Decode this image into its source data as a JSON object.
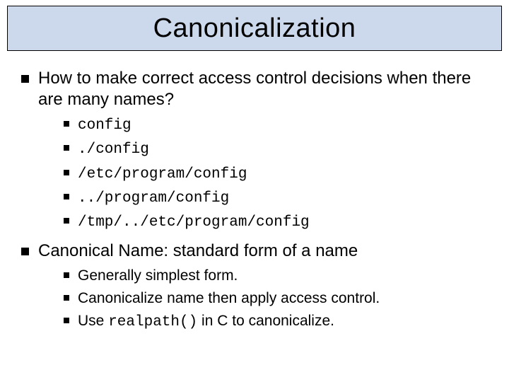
{
  "title": "Canonicalization",
  "points": [
    {
      "text": "How to make correct access control decisions when there are many names?",
      "sub": [
        {
          "text": "config",
          "mono": true
        },
        {
          "text": "./config",
          "mono": true
        },
        {
          "text": "/etc/program/config",
          "mono": true
        },
        {
          "text": "../program/config",
          "mono": true
        },
        {
          "text": "/tmp/../etc/program/config",
          "mono": true
        }
      ]
    },
    {
      "text": "Canonical Name: standard form of a name",
      "sub": [
        {
          "text": "Generally simplest form.",
          "mono": false
        },
        {
          "text": "Canonicalize name then apply access control.",
          "mono": false
        },
        {
          "before": "Use ",
          "code": "realpath()",
          "after": " in C to canonicalize.",
          "mixed": true
        }
      ]
    }
  ]
}
